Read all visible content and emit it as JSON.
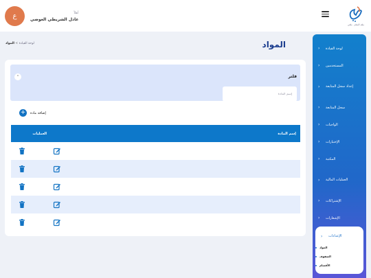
{
  "header": {
    "greeting": "أهلاً",
    "username": "عادل الشريطي العوضي",
    "avatar_initial": "ع",
    "logo_caption": "ملف المعلم · ملفي",
    "menu_icon": "hamburger-icon"
  },
  "sidebar": {
    "items": [
      {
        "label": "لوحة القيادة",
        "icon": "chevron-left-icon"
      },
      {
        "label": "المستخدمين",
        "icon": "chevron-left-icon"
      },
      {
        "label": "إعداد سجل المتابعة",
        "icon": "chevron-left-icon"
      },
      {
        "label": "سجل المتابعة",
        "icon": "chevron-left-icon"
      },
      {
        "label": "الواجبات",
        "icon": "chevron-left-icon"
      },
      {
        "label": "الإختبارات",
        "icon": "chevron-left-icon"
      },
      {
        "label": "المكتبة",
        "icon": "chevron-left-icon"
      },
      {
        "label": "العمليات المالية",
        "icon": "chevron-left-icon"
      },
      {
        "label": "الإشتراكات",
        "icon": "chevron-left-icon"
      },
      {
        "label": "الإشعارات",
        "icon": "chevron-left-icon"
      }
    ],
    "settings": {
      "label": "الإعدادات",
      "icon": "chevron-down-icon",
      "sub_items": [
        "المواد",
        "الصفوف",
        "الأقسام"
      ]
    }
  },
  "page": {
    "title": "المواد",
    "breadcrumb": {
      "parent": "لوحة القيادة",
      "separator": ">",
      "current": "المواد"
    }
  },
  "filter": {
    "title": "فلتر",
    "collapse_icon": "chevron-up-icon",
    "input_placeholder": "إسم المادة",
    "input_value": ""
  },
  "add_button": {
    "label": "إضافة مادة",
    "icon": "plus-circle-icon"
  },
  "table": {
    "columns": [
      "إسم المادة",
      "العمليات"
    ],
    "rows": [
      {
        "name": "",
        "edit_icon": "edit-icon",
        "delete_icon": "trash-icon"
      },
      {
        "name": "",
        "edit_icon": "edit-icon",
        "delete_icon": "trash-icon"
      },
      {
        "name": "",
        "edit_icon": "edit-icon",
        "delete_icon": "trash-icon"
      },
      {
        "name": "",
        "edit_icon": "edit-icon",
        "delete_icon": "trash-icon"
      },
      {
        "name": "",
        "edit_icon": "edit-icon",
        "delete_icon": "trash-icon"
      }
    ]
  },
  "colors": {
    "primary": "#0d78ca",
    "accent_avatar": "#e07a4c",
    "title": "#1a3c8e",
    "filter_bg": "#dbe5fb",
    "row_alt": "#e6eefc"
  }
}
